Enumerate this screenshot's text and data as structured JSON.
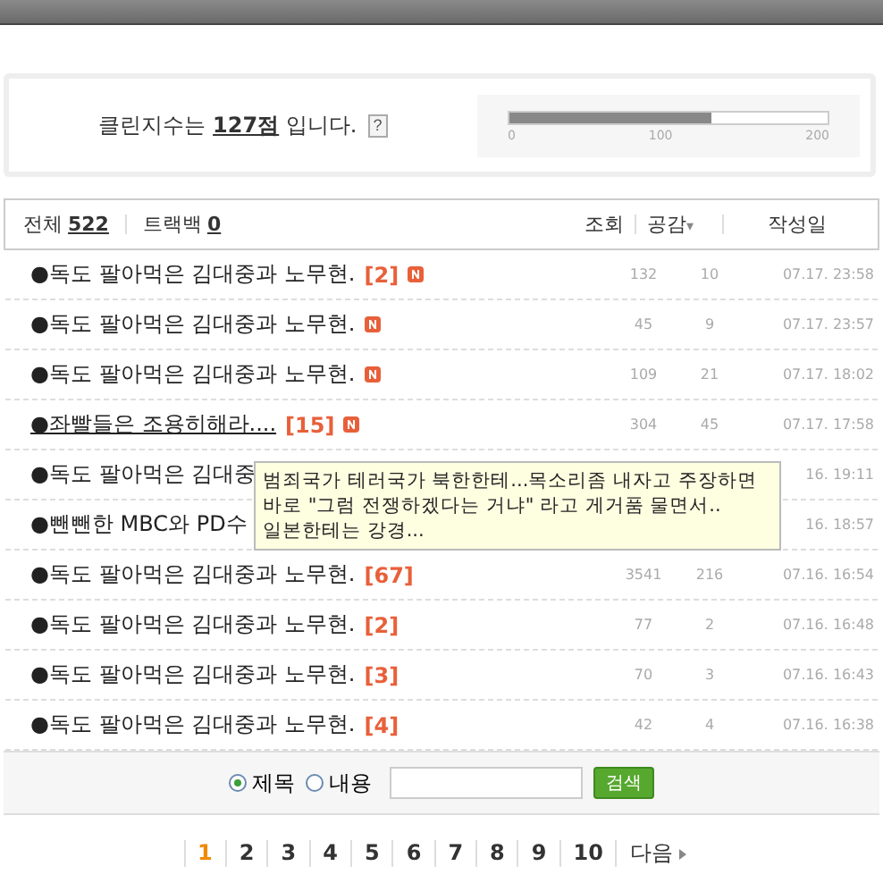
{
  "clean_index": {
    "prefix": "클린지수는 ",
    "score": "127점",
    "suffix": " 입니다.",
    "help": "?",
    "level": 0.635,
    "ticks": [
      "0",
      "100",
      "200"
    ]
  },
  "summary": {
    "total_label": "전체",
    "total": "522",
    "trackback_label": "트랙백",
    "trackback": "0"
  },
  "columns": {
    "views": "조회",
    "likes": "공감",
    "sort_icon": "▾",
    "date": "작성일"
  },
  "rows": [
    {
      "title": "●독도 팔아먹은 김대중과 노무현.",
      "comments": "[2]",
      "new": true,
      "hovered": false,
      "views": "132",
      "likes": "10",
      "date": "07.17. 23:58"
    },
    {
      "title": "●독도 팔아먹은 김대중과 노무현.",
      "new": true,
      "hovered": false,
      "views": "45",
      "likes": "9",
      "date": "07.17. 23:57"
    },
    {
      "title": "●독도 팔아먹은 김대중과 노무현.",
      "new": true,
      "hovered": false,
      "views": "109",
      "likes": "21",
      "date": "07.17. 18:02"
    },
    {
      "title": "●좌빨들은 조용히해라....",
      "comments": "[15]",
      "new": true,
      "hovered": true,
      "views": "304",
      "likes": "45",
      "date": "07.17. 17:58"
    },
    {
      "title": "●독도 팔아먹은 김대중",
      "new": false,
      "hovered": false,
      "date": "16. 19:11"
    },
    {
      "title": "●뺀뺀한 MBC와 PD수",
      "new": false,
      "hovered": false,
      "date": "16. 18:57"
    },
    {
      "title": "●독도 팔아먹은 김대중과 노무현.",
      "comments": "[67]",
      "new": false,
      "hovered": false,
      "views": "3541",
      "likes": "216",
      "date": "07.16. 16:54"
    },
    {
      "title": "●독도 팔아먹은 김대중과 노무현.",
      "comments": "[2]",
      "new": false,
      "hovered": false,
      "views": "77",
      "likes": "2",
      "date": "07.16. 16:48"
    },
    {
      "title": "●독도 팔아먹은 김대중과 노무현.",
      "comments": "[3]",
      "new": false,
      "hovered": false,
      "views": "70",
      "likes": "3",
      "date": "07.16. 16:43"
    },
    {
      "title": "●독도 팔아먹은 김대중과 노무현.",
      "comments": "[4]",
      "new": false,
      "hovered": false,
      "views": "42",
      "likes": "4",
      "date": "07.16. 16:38"
    }
  ],
  "tooltip": "범죄국가 테러국가 북한한테...목소리좀 내자고 주장하면      바로 \"그럼 전쟁하겠다는 거냐\" 라고 게거품 물면서..      일본한테는 강경...",
  "search": {
    "options": [
      {
        "label": "제목",
        "selected": true
      },
      {
        "label": "내용",
        "selected": false
      }
    ],
    "button": "검색"
  },
  "pagination": {
    "pages": [
      {
        "label": "1",
        "selected": true
      },
      {
        "label": "2",
        "selected": false
      },
      {
        "label": "3",
        "selected": false
      },
      {
        "label": "4",
        "selected": false
      },
      {
        "label": "5",
        "selected": false
      },
      {
        "label": "6",
        "selected": false
      },
      {
        "label": "7",
        "selected": false
      },
      {
        "label": "8",
        "selected": false
      },
      {
        "label": "9",
        "selected": false
      },
      {
        "label": "10",
        "selected": false
      }
    ],
    "next": "다음"
  }
}
